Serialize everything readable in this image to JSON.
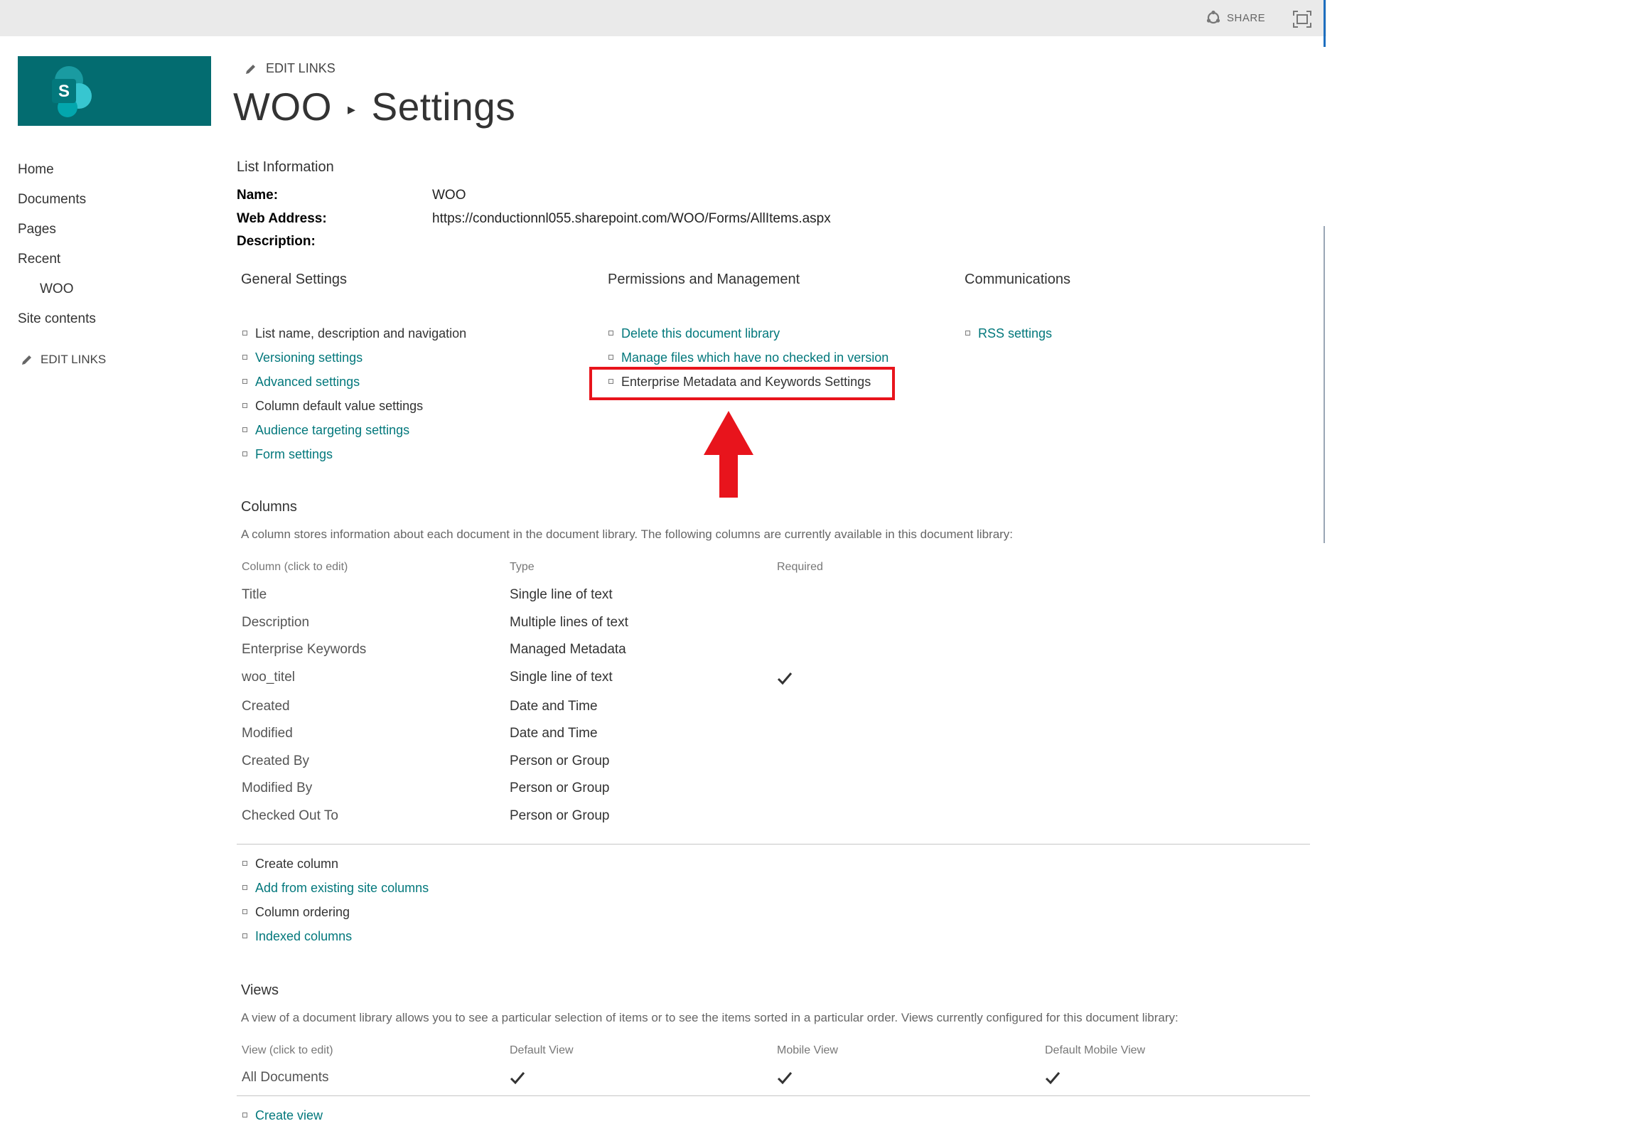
{
  "topbar": {
    "share_label": "SHARE"
  },
  "brand": {
    "logo_letter": "S"
  },
  "nav": {
    "items": [
      {
        "label": "Home",
        "indent": false
      },
      {
        "label": "Documents",
        "indent": false
      },
      {
        "label": "Pages",
        "indent": false
      },
      {
        "label": "Recent",
        "indent": false
      },
      {
        "label": "WOO",
        "indent": true
      },
      {
        "label": "Site contents",
        "indent": false
      }
    ],
    "edit_links": "EDIT LINKS"
  },
  "header": {
    "edit_links": "EDIT LINKS",
    "breadcrumb_site": "WOO",
    "breadcrumb_page": "Settings"
  },
  "list_info": {
    "heading": "List Information",
    "name_label": "Name:",
    "name_value": "WOO",
    "address_label": "Web Address:",
    "address_value": "https://conductionnl055.sharepoint.com/WOO/Forms/AllItems.aspx",
    "description_label": "Description:"
  },
  "general": {
    "heading": "General Settings",
    "links": [
      {
        "label": "List name, description and navigation",
        "style": "dark"
      },
      {
        "label": "Versioning settings",
        "style": "teal"
      },
      {
        "label": "Advanced settings",
        "style": "teal"
      },
      {
        "label": "Column default value settings",
        "style": "dark"
      },
      {
        "label": "Audience targeting settings",
        "style": "teal"
      },
      {
        "label": "Form settings",
        "style": "teal"
      }
    ]
  },
  "permissions": {
    "heading": "Permissions and Management",
    "links": [
      {
        "label": "Delete this document library",
        "style": "teal"
      },
      {
        "label": "Manage files which have no checked in version",
        "style": "teal"
      },
      {
        "label": "Enterprise Metadata and Keywords Settings",
        "style": "dark"
      }
    ]
  },
  "communications": {
    "heading": "Communications",
    "links": [
      {
        "label": "RSS settings",
        "style": "teal"
      }
    ]
  },
  "annotation": {
    "color": "#e8141c"
  },
  "columns": {
    "heading": "Columns",
    "description": "A column stores information about each document in the document library. The following columns are currently available in this document library:",
    "headers": [
      "Column (click to edit)",
      "Type",
      "Required"
    ],
    "rows": [
      {
        "name": "Title",
        "type": "Single line of text",
        "required": false
      },
      {
        "name": "Description",
        "type": "Multiple lines of text",
        "required": false
      },
      {
        "name": "Enterprise Keywords",
        "type": "Managed Metadata",
        "required": false
      },
      {
        "name": "woo_titel",
        "type": "Single line of text",
        "required": true
      },
      {
        "name": "Created",
        "type": "Date and Time",
        "required": false
      },
      {
        "name": "Modified",
        "type": "Date and Time",
        "required": false
      },
      {
        "name": "Created By",
        "type": "Person or Group",
        "required": false
      },
      {
        "name": "Modified By",
        "type": "Person or Group",
        "required": false
      },
      {
        "name": "Checked Out To",
        "type": "Person or Group",
        "required": false
      }
    ],
    "links": [
      {
        "label": "Create column",
        "style": "dark"
      },
      {
        "label": "Add from existing site columns",
        "style": "teal"
      },
      {
        "label": "Column ordering",
        "style": "dark"
      },
      {
        "label": "Indexed columns",
        "style": "teal"
      }
    ]
  },
  "views": {
    "heading": "Views",
    "description": "A view of a document library allows you to see a particular selection of items or to see the items sorted in a particular order. Views currently configured for this document library:",
    "headers": [
      "View (click to edit)",
      "Default View",
      "Mobile View",
      "Default Mobile View"
    ],
    "rows": [
      {
        "name": "All Documents",
        "default_view": true,
        "mobile_view": true,
        "default_mobile_view": true
      }
    ],
    "links": [
      {
        "label": "Create view",
        "style": "teal"
      }
    ]
  },
  "colors": {
    "link_teal": "#03787c",
    "brand": "#036c70",
    "suite_bar": "#eaeaea"
  }
}
